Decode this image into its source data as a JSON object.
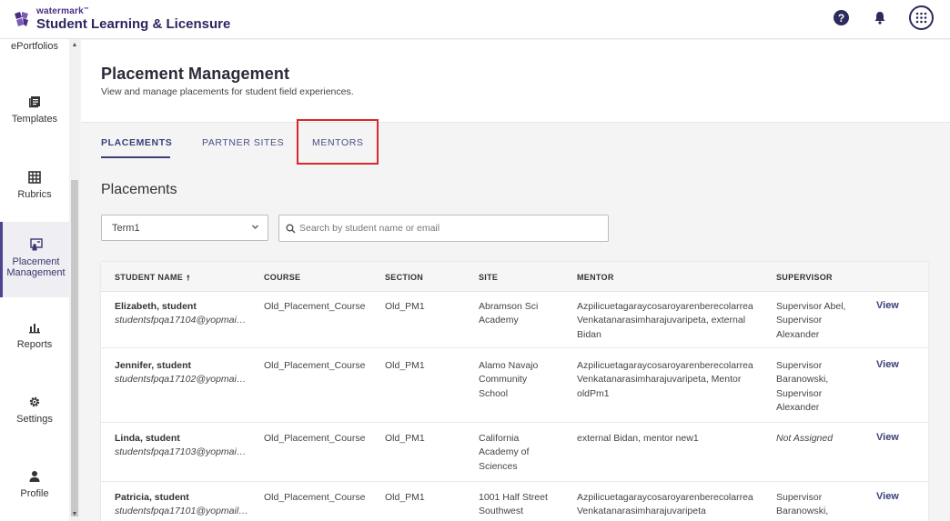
{
  "app": {
    "brand_small": "watermark",
    "brand_tm": "™",
    "brand_title": "Student Learning & Licensure",
    "help_label": "?"
  },
  "sidebar": {
    "items": [
      {
        "label": "ePortfolios",
        "icon": "portfolio-icon"
      },
      {
        "label": "Templates",
        "icon": "templates-icon"
      },
      {
        "label": "Rubrics",
        "icon": "grid-icon"
      },
      {
        "label": "Placement",
        "label2": "Management",
        "icon": "placement-icon",
        "active": true
      },
      {
        "label": "Reports",
        "icon": "bar-chart-icon"
      },
      {
        "label": "Settings",
        "icon": "gear-icon"
      },
      {
        "label": "Profile",
        "icon": "person-icon"
      }
    ]
  },
  "page": {
    "title": "Placement Management",
    "subtitle": "View and manage placements for student field experiences."
  },
  "tabs": [
    {
      "label": "PLACEMENTS",
      "active": true
    },
    {
      "label": "PARTNER SITES",
      "active": false
    },
    {
      "label": "MENTORS",
      "active": false
    }
  ],
  "section": {
    "title": "Placements"
  },
  "filters": {
    "term_value": "Term1",
    "search_placeholder": "Search by student name or email"
  },
  "table": {
    "headers": {
      "student": "STUDENT NAME",
      "sort": "🠕",
      "course": "COURSE",
      "section": "SECTION",
      "site": "SITE",
      "mentor": "MENTOR",
      "supervisor": "SUPERVISOR"
    },
    "view_label": "View",
    "rows": [
      {
        "name": "Elizabeth, student",
        "email": "studentsfpqa17104@yopmai…",
        "course": "Old_Placement_Course",
        "section": "Old_PM1",
        "site": [
          "Abramson Sci",
          "Academy"
        ],
        "mentor": [
          "Azpilicuetagaraycosaroyarenberecolarrea",
          "Venkatanarasimharajuvaripeta, external",
          "Bidan"
        ],
        "supervisor": [
          "Supervisor Abel,",
          "Supervisor",
          "Alexander"
        ]
      },
      {
        "name": "Jennifer, student",
        "email": "studentsfpqa17102@yopmai…",
        "course": "Old_Placement_Course",
        "section": "Old_PM1",
        "site": [
          "Alamo Navajo",
          "Community",
          "School"
        ],
        "mentor": [
          "Azpilicuetagaraycosaroyarenberecolarrea",
          "Venkatanarasimharajuvaripeta, Mentor",
          "oldPm1"
        ],
        "supervisor": [
          "Supervisor",
          "Baranowski,",
          "Supervisor",
          "Alexander"
        ]
      },
      {
        "name": "Linda, student",
        "email": "studentsfpqa17103@yopmai…",
        "course": "Old_Placement_Course",
        "section": "Old_PM1",
        "site": [
          "California",
          "Academy of",
          "Sciences"
        ],
        "mentor": [
          "external Bidan, mentor new1"
        ],
        "supervisor_not_assigned": "Not Assigned"
      },
      {
        "name": "Patricia, student",
        "email": "studentsfpqa17101@yopmail…",
        "course": "Old_Placement_Course",
        "section": "Old_PM1",
        "site": [
          "1001 Half Street",
          "Southwest"
        ],
        "mentor": [
          "Azpilicuetagaraycosaroyarenberecolarrea",
          "Venkatanarasimharajuvaripeta"
        ],
        "supervisor": [
          "Supervisor",
          "Baranowski,"
        ]
      }
    ]
  },
  "colors": {
    "accent": "#3a3f7a",
    "highlight": "#d9262c"
  }
}
